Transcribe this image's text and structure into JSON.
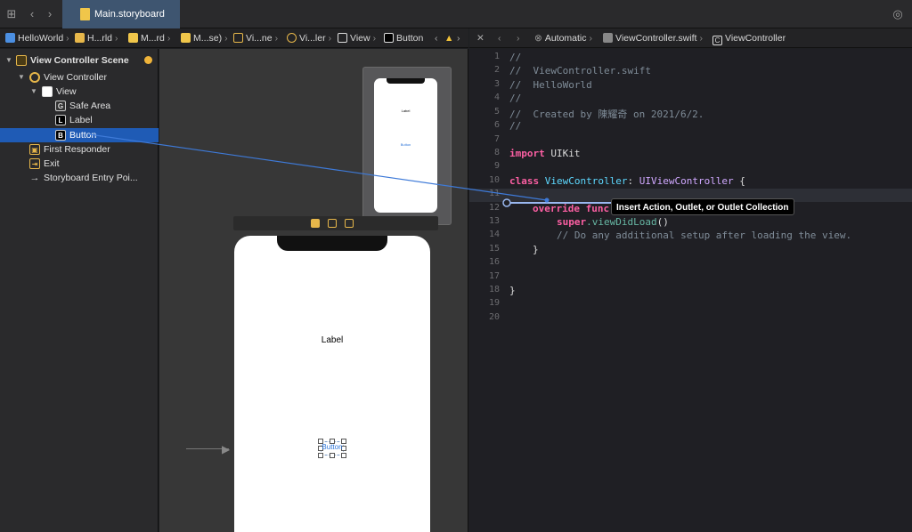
{
  "tab": {
    "title": "Main.storyboard"
  },
  "left_breadcrumbs": [
    "HelloWorld",
    "H...rld",
    "M...rd",
    "M...se)",
    "Vi...ne",
    "Vi...ler",
    "View",
    "Button"
  ],
  "right_breadcrumbs": [
    "Automatic",
    "ViewController.swift",
    "ViewController"
  ],
  "outline": {
    "scene": "View Controller Scene",
    "vc": "View Controller",
    "view": "View",
    "safe_area": "Safe Area",
    "label": "Label",
    "button": "Button",
    "first_responder": "First Responder",
    "exit": "Exit",
    "entry": "Storyboard Entry Poi..."
  },
  "canvas": {
    "small_label": "Label",
    "small_button": "Button",
    "label": "Label",
    "button": "Button"
  },
  "editor": {
    "line_numbers": [
      "1",
      "2",
      "3",
      "4",
      "5",
      "6",
      "7",
      "8",
      "9",
      "10",
      "11",
      "12",
      "13",
      "14",
      "15",
      "16",
      "17",
      "18",
      "19",
      "20"
    ],
    "c1": "//",
    "c2": "//  ViewController.swift",
    "c3": "//  HelloWorld",
    "c4": "//",
    "c5": "//  Created by 陳耀奇 on 2021/6/2.",
    "c6": "//",
    "import_kw": "import",
    "import_mod": " UIKit",
    "class_kw": "class",
    "class_name": " ViewController",
    "colon": ": ",
    "superclass": "UIViewController",
    "brace_open": " {",
    "override_kw": "override func",
    "super_kw": "super",
    "viewdidload": ".viewDidLoad",
    "parens": "()",
    "comment_setup": "// Do any additional setup after loading the view.",
    "brace_close_inner": "}",
    "brace_close_outer": "}"
  },
  "tooltip": "Insert Action, Outlet, or Outlet Collection",
  "colors": {
    "selection": "#1f5bb5",
    "tab_active": "#3e5570",
    "wire": "#3e7ad8",
    "keyword": "#fc5fa3"
  }
}
